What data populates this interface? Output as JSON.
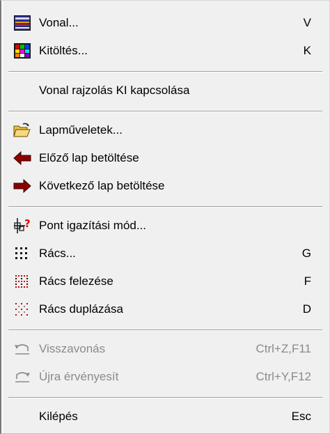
{
  "menu": {
    "items": [
      {
        "label": "Vonal...",
        "shortcut": "V",
        "icon": "line-style-icon"
      },
      {
        "label": "Kitöltés...",
        "shortcut": "K",
        "icon": "fill-palette-icon"
      },
      {
        "label": "Vonal rajzolás KI kapcsolása",
        "shortcut": ""
      },
      {
        "label": "Lapműveletek...",
        "shortcut": "",
        "icon": "open-folder-icon"
      },
      {
        "label": "Előző lap betöltése",
        "shortcut": "",
        "icon": "arrow-left-icon"
      },
      {
        "label": "Következő lap betöltése",
        "shortcut": "",
        "icon": "arrow-right-icon"
      },
      {
        "label": "Pont igazítási mód...",
        "shortcut": "",
        "icon": "snap-point-icon"
      },
      {
        "label": "Rács...",
        "shortcut": "G",
        "icon": "grid-icon"
      },
      {
        "label": "Rács felezése",
        "shortcut": "F",
        "icon": "grid-halve-icon"
      },
      {
        "label": "Rács duplázása",
        "shortcut": "D",
        "icon": "grid-double-icon"
      },
      {
        "label": "Visszavonás",
        "shortcut": "Ctrl+Z,F11",
        "icon": "undo-icon",
        "disabled": true
      },
      {
        "label": "Újra érvényesít",
        "shortcut": "Ctrl+Y,F12",
        "icon": "redo-icon",
        "disabled": true
      },
      {
        "label": "Kilépés",
        "shortcut": "Esc"
      }
    ]
  },
  "colors": {
    "arrow_red": "#8b0000",
    "disabled_text": "#8a8a8a",
    "menu_bg": "#f0f0f0"
  }
}
